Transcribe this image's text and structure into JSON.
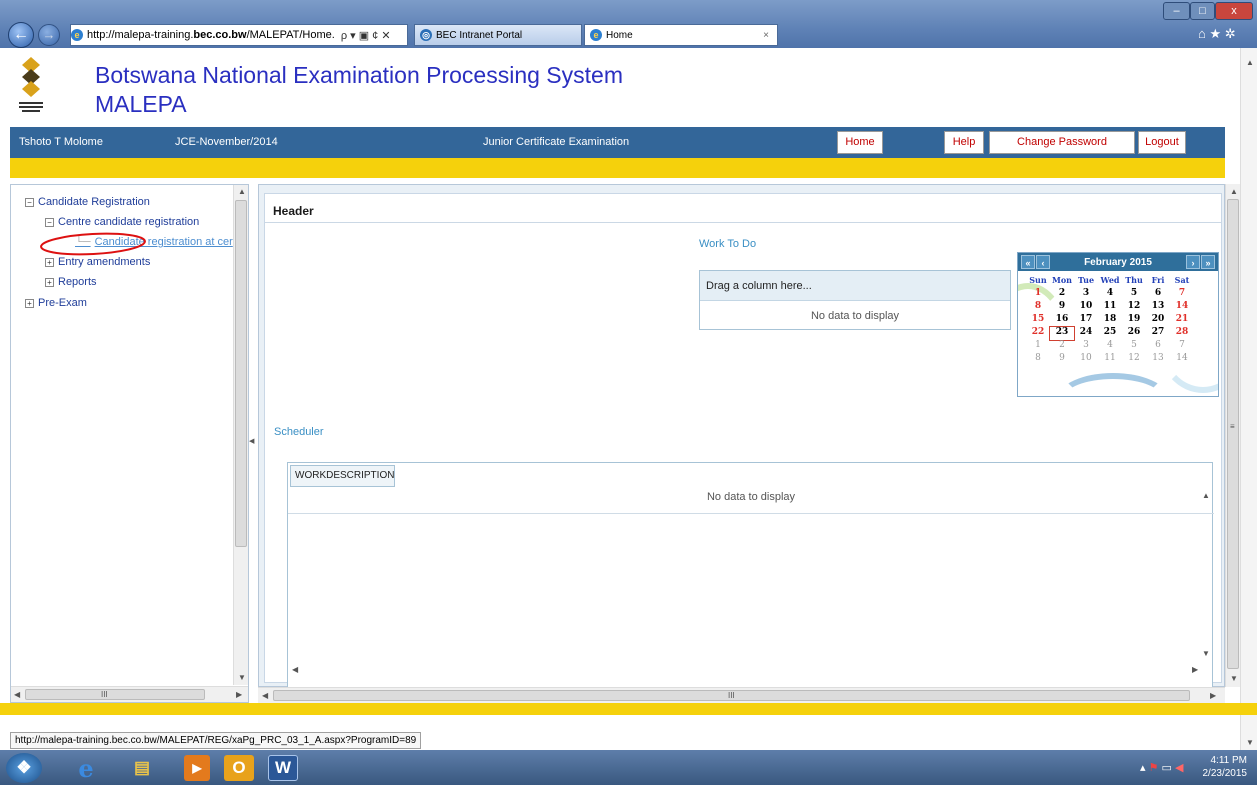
{
  "browser": {
    "url": "http://malepa-training.bec.co.bw/MALEPAT/Home.",
    "url_domain_bold": "bec.co.bw",
    "url_prefix": "http://malepa-training.",
    "url_suffix": "/MALEPAT/Home.",
    "addr_icons": "ρ ▾ ▣ ¢ ✕",
    "tabs": [
      {
        "label": "BEC Intranet Portal"
      },
      {
        "label": "Home"
      }
    ],
    "tab_close": "×",
    "controls": {
      "minimize": "–",
      "maximize": "□",
      "close": "x"
    },
    "toolbar_icons": "⌂ ★ ✲"
  },
  "header": {
    "title": "Botswana National Examination Processing System",
    "app_name": "MALEPA",
    "logo_text": "BOTSWANA EXAMINATIONS COUNCIL"
  },
  "infobar": {
    "user": "Tshoto T Molome",
    "session": "JCE-November/2014",
    "exam": "Junior Certificate Examination",
    "buttons": {
      "home": "Home",
      "help": "Help",
      "change_password": "Change Password",
      "logout": "Logout"
    }
  },
  "tree": {
    "items": [
      {
        "label": "Candidate Registration",
        "expander": "⊟"
      },
      {
        "label": "Centre candidate registration",
        "expander": "⊟"
      },
      {
        "label": "Candidate registration at cer"
      },
      {
        "label": "Entry amendments",
        "expander": "⊞"
      },
      {
        "label": "Reports",
        "expander": "⊞"
      },
      {
        "label": "Pre-Exam",
        "expander": "⊞"
      }
    ]
  },
  "content": {
    "header_label": "Header",
    "work_to_do": "Work To Do",
    "work_grid": {
      "group_prompt": "Drag a column here...",
      "empty_text": "No data to display"
    },
    "scheduler": "Scheduler",
    "sched_grid": {
      "column": "WORKDESCRIPTION",
      "empty_text": "No data to display"
    }
  },
  "calendar": {
    "month_label": "February 2015",
    "nav": {
      "prev_year": "«",
      "prev_month": "‹",
      "next_month": "›",
      "next_year": "»"
    },
    "days_of_week": [
      "Sun",
      "Mon",
      "Tue",
      "Wed",
      "Thu",
      "Fri",
      "Sat"
    ],
    "weeks": [
      [
        "1",
        "2",
        "3",
        "4",
        "5",
        "6",
        "7"
      ],
      [
        "8",
        "9",
        "10",
        "11",
        "12",
        "13",
        "14"
      ],
      [
        "15",
        "16",
        "17",
        "18",
        "19",
        "20",
        "21"
      ],
      [
        "22",
        "23",
        "24",
        "25",
        "26",
        "27",
        "28"
      ],
      [
        "1",
        "2",
        "3",
        "4",
        "5",
        "6",
        "7"
      ],
      [
        "8",
        "9",
        "10",
        "11",
        "12",
        "13",
        "14"
      ]
    ],
    "today": "23"
  },
  "status_url": "http://malepa-training.bec.co.bw/MALEPAT/REG/xaPg_PRC_03_1_A.aspx?ProgramID=89",
  "scroll": {
    "h_grip": "III",
    "v_grip": "≡"
  },
  "taskbar": {
    "apps": [
      {
        "name": "start",
        "glyph": "❖"
      },
      {
        "name": "internet-explorer",
        "glyph": "e"
      },
      {
        "name": "file-explorer",
        "glyph": "▤"
      },
      {
        "name": "media-player",
        "glyph": "▶"
      },
      {
        "name": "outlook",
        "glyph": "O"
      },
      {
        "name": "word",
        "glyph": "W"
      }
    ],
    "time": "4:11 PM",
    "date": "2/23/2015"
  }
}
